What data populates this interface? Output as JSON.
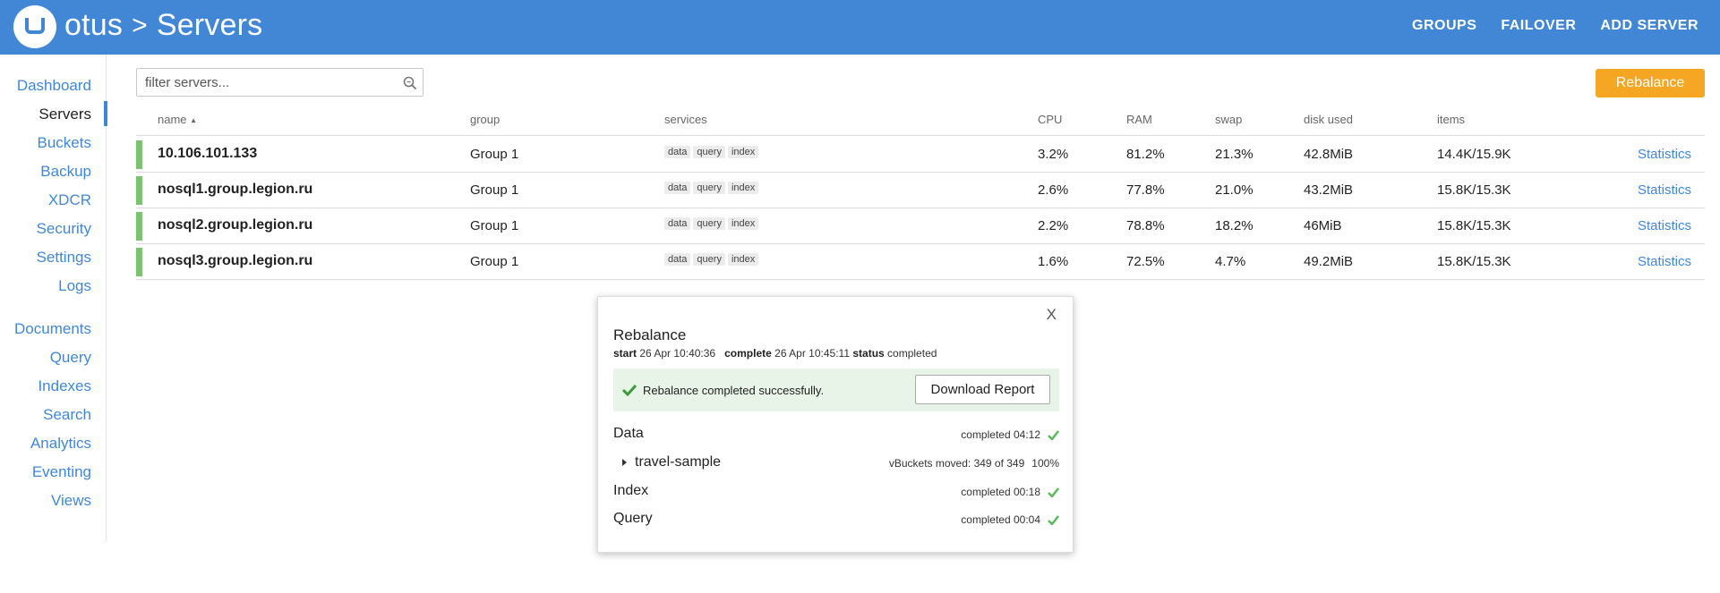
{
  "header": {
    "app": "otus",
    "separator": ">",
    "page": "Servers",
    "nav": [
      "GROUPS",
      "FAILOVER",
      "ADD SERVER"
    ]
  },
  "sidebar": {
    "items": [
      {
        "label": "Dashboard"
      },
      {
        "label": "Servers",
        "active": true
      },
      {
        "label": "Buckets"
      },
      {
        "label": "Backup"
      },
      {
        "label": "XDCR"
      },
      {
        "label": "Security"
      },
      {
        "label": "Settings"
      },
      {
        "label": "Logs"
      },
      {
        "label": "Documents"
      },
      {
        "label": "Query"
      },
      {
        "label": "Indexes"
      },
      {
        "label": "Search"
      },
      {
        "label": "Analytics"
      },
      {
        "label": "Eventing"
      },
      {
        "label": "Views"
      }
    ]
  },
  "filter": {
    "placeholder": "filter servers...",
    "value": ""
  },
  "rebalance_button": "Rebalance",
  "table": {
    "columns": [
      "name",
      "group",
      "services",
      "CPU",
      "RAM",
      "swap",
      "disk used",
      "items"
    ],
    "sort_indicator": "▲",
    "rows": [
      {
        "name": "10.106.101.133",
        "group": "Group 1",
        "services": [
          "data",
          "query",
          "index"
        ],
        "cpu": "3.2%",
        "ram": "81.2%",
        "swap": "21.3%",
        "disk": "42.8MiB",
        "items": "14.4K/15.9K",
        "link": "Statistics"
      },
      {
        "name": "nosql1.group.legion.ru",
        "group": "Group 1",
        "services": [
          "data",
          "query",
          "index"
        ],
        "cpu": "2.6%",
        "ram": "77.8%",
        "swap": "21.0%",
        "disk": "43.2MiB",
        "items": "15.8K/15.3K",
        "link": "Statistics"
      },
      {
        "name": "nosql2.group.legion.ru",
        "group": "Group 1",
        "services": [
          "data",
          "query",
          "index"
        ],
        "cpu": "2.2%",
        "ram": "78.8%",
        "swap": "18.2%",
        "disk": "46MiB",
        "items": "15.8K/15.3K",
        "link": "Statistics"
      },
      {
        "name": "nosql3.group.legion.ru",
        "group": "Group 1",
        "services": [
          "data",
          "query",
          "index"
        ],
        "cpu": "1.6%",
        "ram": "72.5%",
        "swap": "4.7%",
        "disk": "49.2MiB",
        "items": "15.8K/15.3K",
        "link": "Statistics"
      }
    ]
  },
  "dialog": {
    "close": "X",
    "title": "Rebalance",
    "start_label": "start",
    "start": "26 Apr 10:40:36",
    "complete_label": "complete",
    "complete": "26 Apr 10:45:11",
    "status_label": "status",
    "status": "completed",
    "success_msg": "Rebalance completed successfully.",
    "download_label": "Download Report",
    "sections": [
      {
        "label": "Data",
        "status": "completed 04:12"
      },
      {
        "label": "travel-sample",
        "status": "vBuckets moved: 349 of 349",
        "percent": "100%"
      },
      {
        "label": "Index",
        "status": "completed 00:18"
      },
      {
        "label": "Query",
        "status": "completed 00:04"
      }
    ]
  },
  "colors": {
    "header": "#4287d6",
    "accent": "#4287d6",
    "rebalance": "#f5a623",
    "healthy": "#7cc36f",
    "success_bg": "#e8f4e8",
    "check": "#5cb85c"
  }
}
